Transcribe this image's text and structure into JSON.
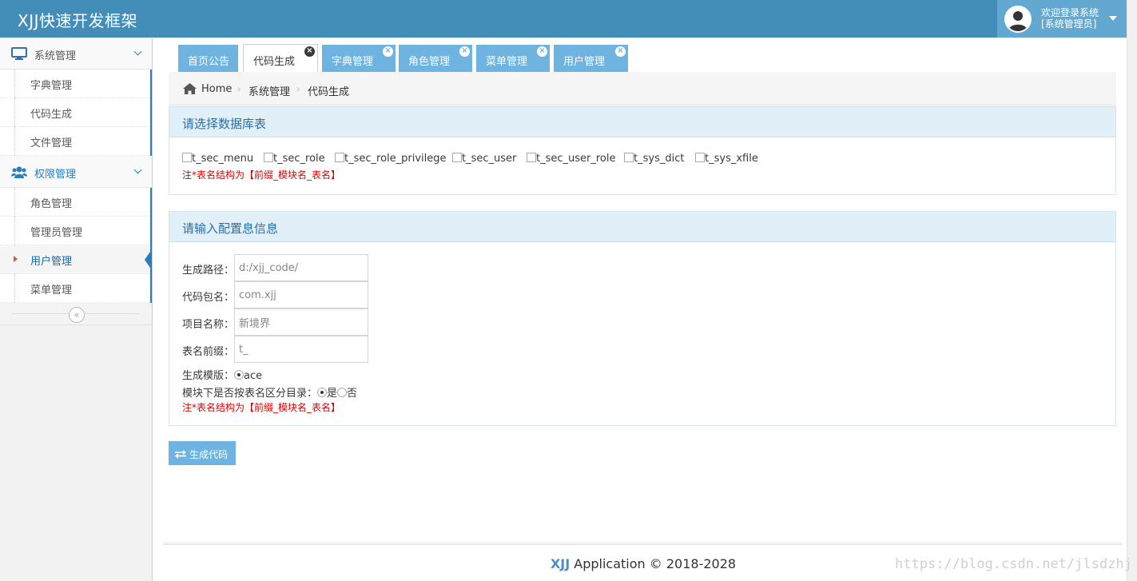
{
  "app": {
    "brand": "XJJ快速开发框架",
    "welcome_line1": "欢迎登录系统",
    "welcome_line2": "[系统管理员]"
  },
  "sidebar": {
    "groups": [
      {
        "label": "系统管理",
        "icon": "desktop-icon",
        "items": [
          "字典管理",
          "代码生成",
          "文件管理"
        ]
      },
      {
        "label": "权限管理",
        "icon": "users-icon",
        "items": [
          "角色管理",
          "管理员管理",
          "用户管理",
          "菜单管理"
        ],
        "active_item": "用户管理"
      }
    ],
    "collapse_symbol": "«"
  },
  "tabs": [
    {
      "label": "首页公告",
      "closable": false,
      "active": false
    },
    {
      "label": "代码生成",
      "closable": true,
      "active": true
    },
    {
      "label": "字典管理",
      "closable": true,
      "active": false
    },
    {
      "label": "角色管理",
      "closable": true,
      "active": false
    },
    {
      "label": "菜单管理",
      "closable": true,
      "active": false
    },
    {
      "label": "用户管理",
      "closable": true,
      "active": false
    }
  ],
  "breadcrumb": [
    "Home",
    "系统管理",
    "代码生成"
  ],
  "panel_tables": {
    "title": "请选择数据库表",
    "tables": [
      "t_sec_menu",
      "t_sec_role",
      "t_sec_role_privilege",
      "t_sec_user",
      "t_sec_user_role",
      "t_sys_dict",
      "t_sys_xfile"
    ],
    "note": "注*表名结构为【前缀_模块名_表名】"
  },
  "panel_config": {
    "title": "请输入配置息信息",
    "fields": [
      {
        "label": "生成路径：",
        "value": "d:/xjj_code/"
      },
      {
        "label": "代码包名：",
        "value": "com.xjj"
      },
      {
        "label": "项目名称：",
        "value": "新境界"
      },
      {
        "label": "表名前缀：",
        "value": "t_"
      }
    ],
    "template_label": "生成模版：",
    "template_option": "ace",
    "dir_label": "模块下是否按表名区分目录：",
    "dir_yes": "是",
    "dir_no": "否",
    "note": "注*表名结构为【前缀_模块名_表名】"
  },
  "generate_button": "生成代码",
  "footer": {
    "brand": "XJJ",
    "text": "Application © 2018-2028"
  },
  "watermark": "https://blog.csdn.net/jlsdzhj",
  "colors": {
    "navbar": "#438eb9",
    "tab": "#6fb3e0",
    "accent": "#2b7dbc",
    "note": "#dd0000"
  }
}
